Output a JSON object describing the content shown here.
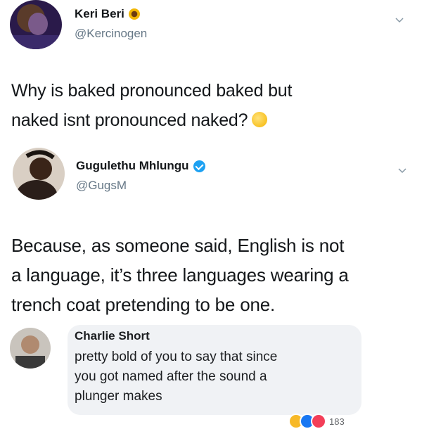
{
  "tweet1": {
    "name": "Keri Beri",
    "handle": "@Kercinogen",
    "text_lines": [
      "Why is baked pronounced baked but",
      "naked isnt pronounced naked?"
    ]
  },
  "tweet2": {
    "name": "Gugulethu Mhlungu",
    "handle": "@GugsM",
    "text_lines": [
      "Because, as someone said, English is not",
      "a language, it’s three languages wearing a",
      "trench coat pretending to be one."
    ]
  },
  "comment": {
    "name": "Charlie Short",
    "text_lines": [
      "pretty bold of you to say that since",
      "you got named after the sound a",
      "plunger makes"
    ],
    "reaction_count": "183"
  },
  "colors": {
    "verified": "#1da1f2",
    "handle": "#657786",
    "comment_bg": "#f0f2f5"
  }
}
